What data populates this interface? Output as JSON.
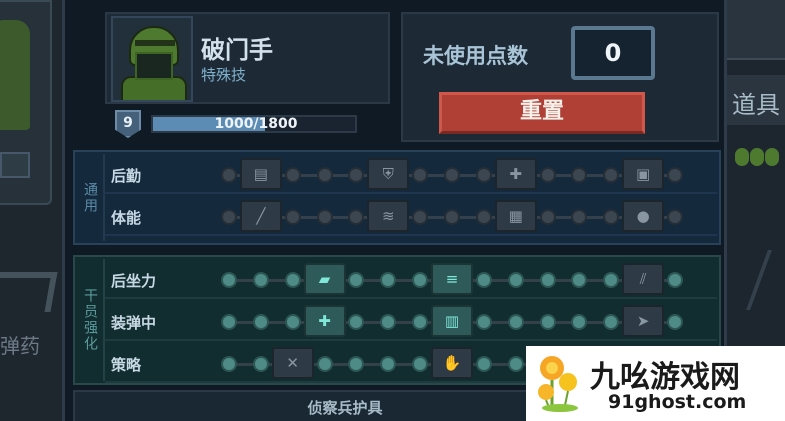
{
  "soldier": {
    "name": "破门手",
    "subtitle": "特殊技",
    "level": "9",
    "xp_text": "1000/1800",
    "xp_fraction": 0.556
  },
  "points": {
    "label": "未使用点数",
    "value": "0",
    "reset_label": "重置"
  },
  "sections": {
    "general": {
      "label": "通用",
      "rows": [
        {
          "name": "后勤",
          "icons": [
            "ammo-belt-icon",
            "shield-plus-icon",
            "medkit-icon",
            "supply-crate-icon"
          ]
        },
        {
          "name": "体能",
          "icons": [
            "knife-icon",
            "sprint-icon",
            "armor-plate-icon",
            "grenade-pack-icon"
          ]
        }
      ]
    },
    "enhance": {
      "label": "干员强化",
      "rows": [
        {
          "name": "后坐力",
          "icons": [
            "recoil-grip-icon",
            "barrel-icon",
            "stock-icon"
          ]
        },
        {
          "name": "装弹中",
          "icons": [
            "magazine-plus-icon",
            "fast-mag-icon",
            "reload-arrow-icon"
          ]
        },
        {
          "name": "策略",
          "icons": [
            "cross-icon",
            "hand-icon"
          ]
        }
      ]
    }
  },
  "armor": {
    "label": "侦察兵护具"
  },
  "background": {
    "left_text": "弹药",
    "right_title": "道具"
  },
  "watermark": {
    "title": "九吆游戏网",
    "url": "91ghost.com"
  }
}
